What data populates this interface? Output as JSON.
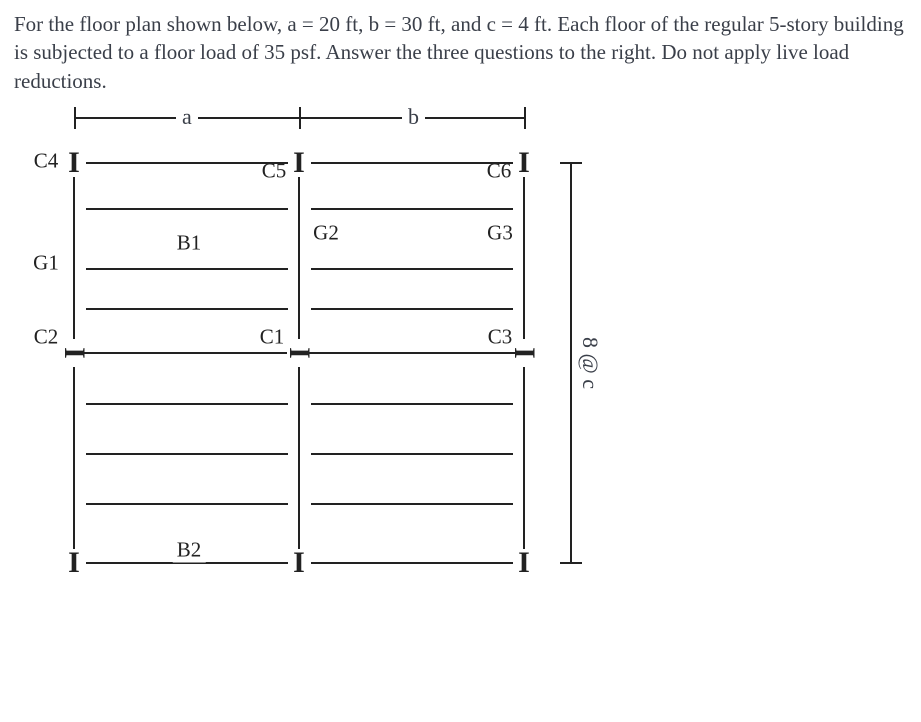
{
  "prompt": "For the floor plan shown below, a = 20 ft, b = 30 ft, and c = 4 ft. Each floor of the regular 5-story building is subjected to a floor load of 35 psf. Answer the three questions to the right. Do not apply live load reductions.",
  "dims": {
    "a": "a",
    "b": "b",
    "side": "8 @ c"
  },
  "labels": {
    "C1": "C1",
    "C2": "C2",
    "C3": "C3",
    "C4": "C4",
    "C5": "C5",
    "C6": "C6",
    "G1": "G1",
    "G2": "G2",
    "G3": "G3",
    "B1": "B1",
    "B2": "B2"
  }
}
